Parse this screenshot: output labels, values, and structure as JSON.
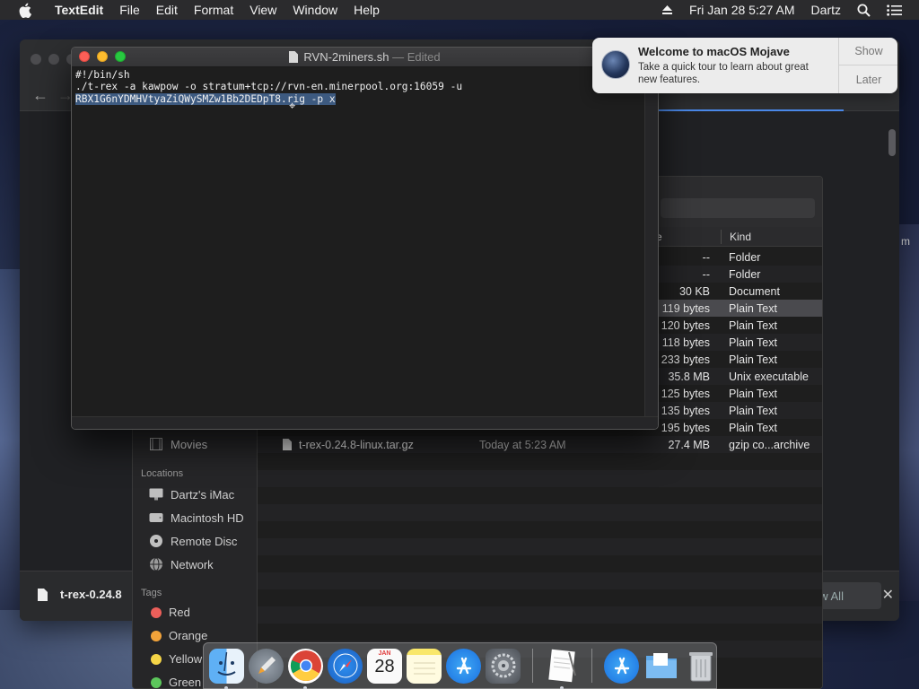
{
  "menubar": {
    "app": "TextEdit",
    "items": [
      "File",
      "Edit",
      "Format",
      "View",
      "Window",
      "Help"
    ],
    "datetime": "Fri Jan 28  5:27 AM",
    "user": "Dartz"
  },
  "textedit": {
    "filename": "RVN-2miners.sh",
    "edited": "— Edited",
    "lines": [
      "#!/bin/sh",
      "./t-rex -a kawpow -o stratum+tcp://rvn-en.minerpool.org:16059 -u"
    ],
    "selected_line": "RBX1G6nYDMHVtyaZiQWySMZw1Bb2DEDpT8.rig -p x"
  },
  "notification": {
    "title": "Welcome to macOS Mojave",
    "body": "Take a quick tour to learn about great new features.",
    "show_label": "Show",
    "later_label": "Later"
  },
  "finder": {
    "columns": {
      "size": "e",
      "kind": "Kind"
    },
    "rows": [
      {
        "size": "--",
        "kind": "Folder"
      },
      {
        "size": "--",
        "kind": "Folder"
      },
      {
        "size": "30 KB",
        "kind": "Document"
      },
      {
        "size": "119 bytes",
        "kind": "Plain Text",
        "selected": true
      },
      {
        "size": "120 bytes",
        "kind": "Plain Text"
      },
      {
        "size": "118 bytes",
        "kind": "Plain Text"
      },
      {
        "size": "233 bytes",
        "kind": "Plain Text"
      },
      {
        "size": "35.8 MB",
        "kind": "Unix executable"
      },
      {
        "size": "125 bytes",
        "kind": "Plain Text"
      },
      {
        "size": "135 bytes",
        "kind": "Plain Text"
      },
      {
        "size": "195 bytes",
        "kind": "Plain Text"
      }
    ],
    "visible_file": {
      "name": "t-rex-0.24.8-linux.tar.gz",
      "date": "Today at 5:23 AM",
      "size": "27.4 MB",
      "kind": "gzip co...archive"
    },
    "sidebar": {
      "movies": "Movies",
      "locations_header": "Locations",
      "locations": [
        "Dartz's iMac",
        "Macintosh HD",
        "Remote Disc",
        "Network"
      ],
      "tags_header": "Tags",
      "tags": [
        {
          "name": "Red",
          "color": "#ec5f5a"
        },
        {
          "name": "Orange",
          "color": "#f2a33a"
        },
        {
          "name": "Yellow",
          "color": "#f5d547"
        },
        {
          "name": "Green",
          "color": "#5cc65b"
        }
      ]
    }
  },
  "browser": {
    "download_file": "t-rex-0.24.8",
    "show_all": "ow All"
  },
  "right_edge_text": "m",
  "dock": {
    "apps": [
      "finder",
      "launchpad",
      "chrome",
      "safari",
      "calendar",
      "notes",
      "app-store",
      "system-preferences",
      "textedit",
      "app-store-folder",
      "documents-folder",
      "trash"
    ],
    "calendar": {
      "month": "JAN",
      "day": "28"
    }
  }
}
